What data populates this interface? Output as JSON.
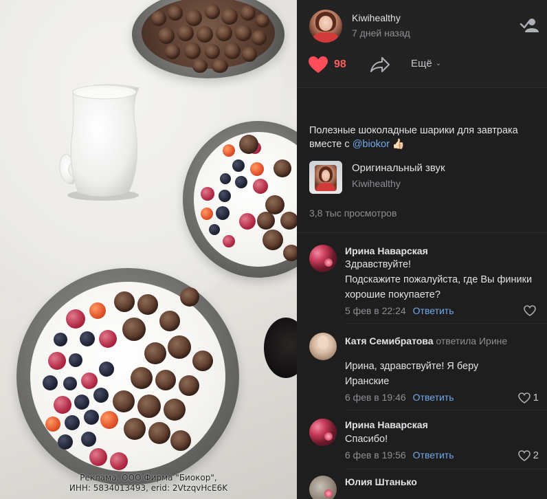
{
  "media": {
    "ad_line1": "Реклама, ООО Фирма \"Биокор\",",
    "ad_line2": "ИНН: 5834013493, erid: 2VtzqvHcE6K"
  },
  "post": {
    "author": "Kiwihealthy",
    "time": "7 дней назад",
    "subscribe_icon": "add-friend-icon",
    "likes": "98",
    "more_label": "Ещё",
    "caption_prefix": "Полезные шоколадные шарики для завтрака вместе с ",
    "mention": "@biokor",
    "caption_suffix": " 👍🏻",
    "audio_title": "Оригинальный звук",
    "audio_author": "Kiwihealthy",
    "views": "3,8 тыс просмотров"
  },
  "comments": [
    {
      "name": "Ирина Наварская",
      "reply_to": "",
      "text": "Здравствуйте!\nПодскажите пожалуйста, где Вы финики хорошие покупаете?",
      "date": "5 фев в 22:24",
      "reply_label": "Ответить",
      "likes": ""
    },
    {
      "name": "Катя Семибратова",
      "reply_to": "ответила Ирине",
      "text": "Ирина, здравствуйте! Я беру Иранские",
      "date": "6 фев в 19:46",
      "reply_label": "Ответить",
      "likes": "1"
    },
    {
      "name": "Ирина Наварская",
      "reply_to": "",
      "text": "Спасибо!",
      "date": "6 фев в 19:56",
      "reply_label": "Ответить",
      "likes": "2"
    },
    {
      "name": "Юлия Штанько",
      "reply_to": "",
      "text": "",
      "date": "",
      "reply_label": "",
      "likes": ""
    }
  ],
  "colors": {
    "panel_bg": "#1e1e1e",
    "like_red": "#ff5c5c",
    "link_blue": "#71aaeb",
    "muted": "#8c8f94"
  }
}
